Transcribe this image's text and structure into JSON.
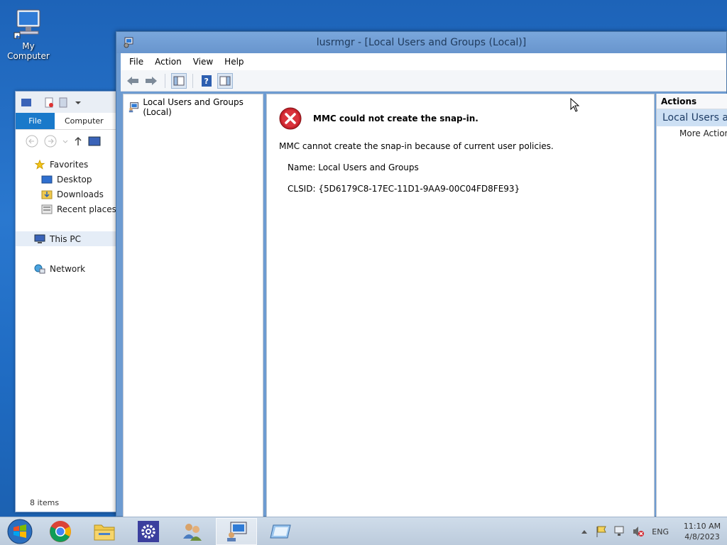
{
  "desktop": {
    "icons": [
      {
        "label": "My Computer",
        "icon": "computer-icon"
      }
    ]
  },
  "explorer": {
    "ribbon": {
      "file_tab": "File",
      "computer_tab": "Computer"
    },
    "nav": {
      "favorites": "Favorites",
      "desktop": "Desktop",
      "downloads": "Downloads",
      "recent_places": "Recent places",
      "this_pc": "This PC",
      "network": "Network"
    },
    "status": "8 items"
  },
  "mmc": {
    "title": "lusrmgr - [Local Users and Groups (Local)]",
    "menu": [
      "File",
      "Action",
      "View",
      "Help"
    ],
    "tree_root": "Local Users and Groups (Local)",
    "error": {
      "title": "MMC could not create the snap-in.",
      "message": "MMC cannot create the snap-in because of current user policies.",
      "name_line": "Name: Local Users and Groups",
      "clsid_line": "CLSID: {5D6179C8-17EC-11D1-9AA9-00C04FD8FE93}"
    },
    "actions": {
      "header": "Actions",
      "section": "Local Users and Groups (Local)",
      "more": "More Actions"
    }
  },
  "taskbar": {
    "items": [
      {
        "icon": "chrome-icon"
      },
      {
        "icon": "file-explorer-icon"
      },
      {
        "icon": "settings-icon"
      },
      {
        "icon": "users-icon"
      },
      {
        "icon": "mmc-computer-icon",
        "active": true
      },
      {
        "icon": "remote-desktop-icon"
      }
    ],
    "tray": {
      "language": "ENG",
      "time": "11:10 AM",
      "date": "4/8/2023"
    }
  }
}
